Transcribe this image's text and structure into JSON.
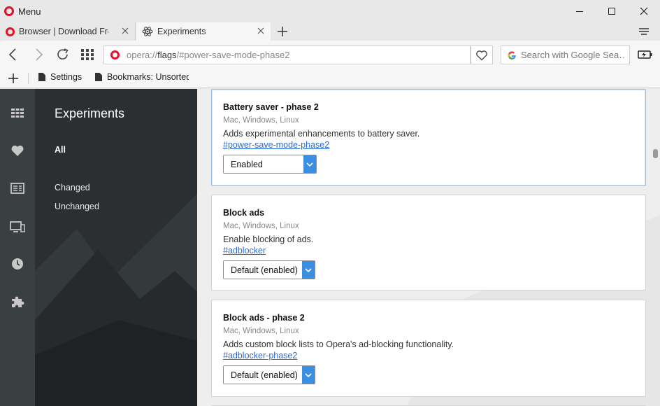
{
  "window": {
    "menu_label": "Menu"
  },
  "tabs": [
    {
      "title": "Browser | Download Free |"
    },
    {
      "title": "Experiments"
    }
  ],
  "address": {
    "url_scheme": "opera://",
    "url_host": "flags",
    "url_rest": "/#power-save-mode-phase2",
    "search_placeholder": "Search with Google Sea…"
  },
  "bookmarks": [
    {
      "label": "Settings"
    },
    {
      "label": "Bookmarks: Unsorted"
    }
  ],
  "sidebar_icons": [
    "speed-dial-icon",
    "heart-icon",
    "news-icon",
    "devices-icon",
    "history-icon",
    "extensions-icon"
  ],
  "panel": {
    "title": "Experiments",
    "links": [
      "All",
      "Changed",
      "Unchanged"
    ]
  },
  "experiments": [
    {
      "title": "Battery saver - phase 2",
      "platforms": "Mac, Windows, Linux",
      "description": "Adds experimental enhancements to battery saver.",
      "link": "#power-save-mode-phase2",
      "value": "Enabled"
    },
    {
      "title": "Block ads",
      "platforms": "Mac, Windows, Linux",
      "description": "Enable blocking of ads.",
      "link": "#adblocker",
      "value": "Default (enabled)"
    },
    {
      "title": "Block ads - phase 2",
      "platforms": "Mac, Windows, Linux",
      "description": "Adds custom block lists to Opera's ad-blocking functionality.",
      "link": "#adblocker-phase2",
      "value": "Default (enabled)"
    }
  ],
  "colors": {
    "opera_red": "#e0122a",
    "select_accent": "#3b8fe3",
    "link": "#2a6bd1"
  }
}
